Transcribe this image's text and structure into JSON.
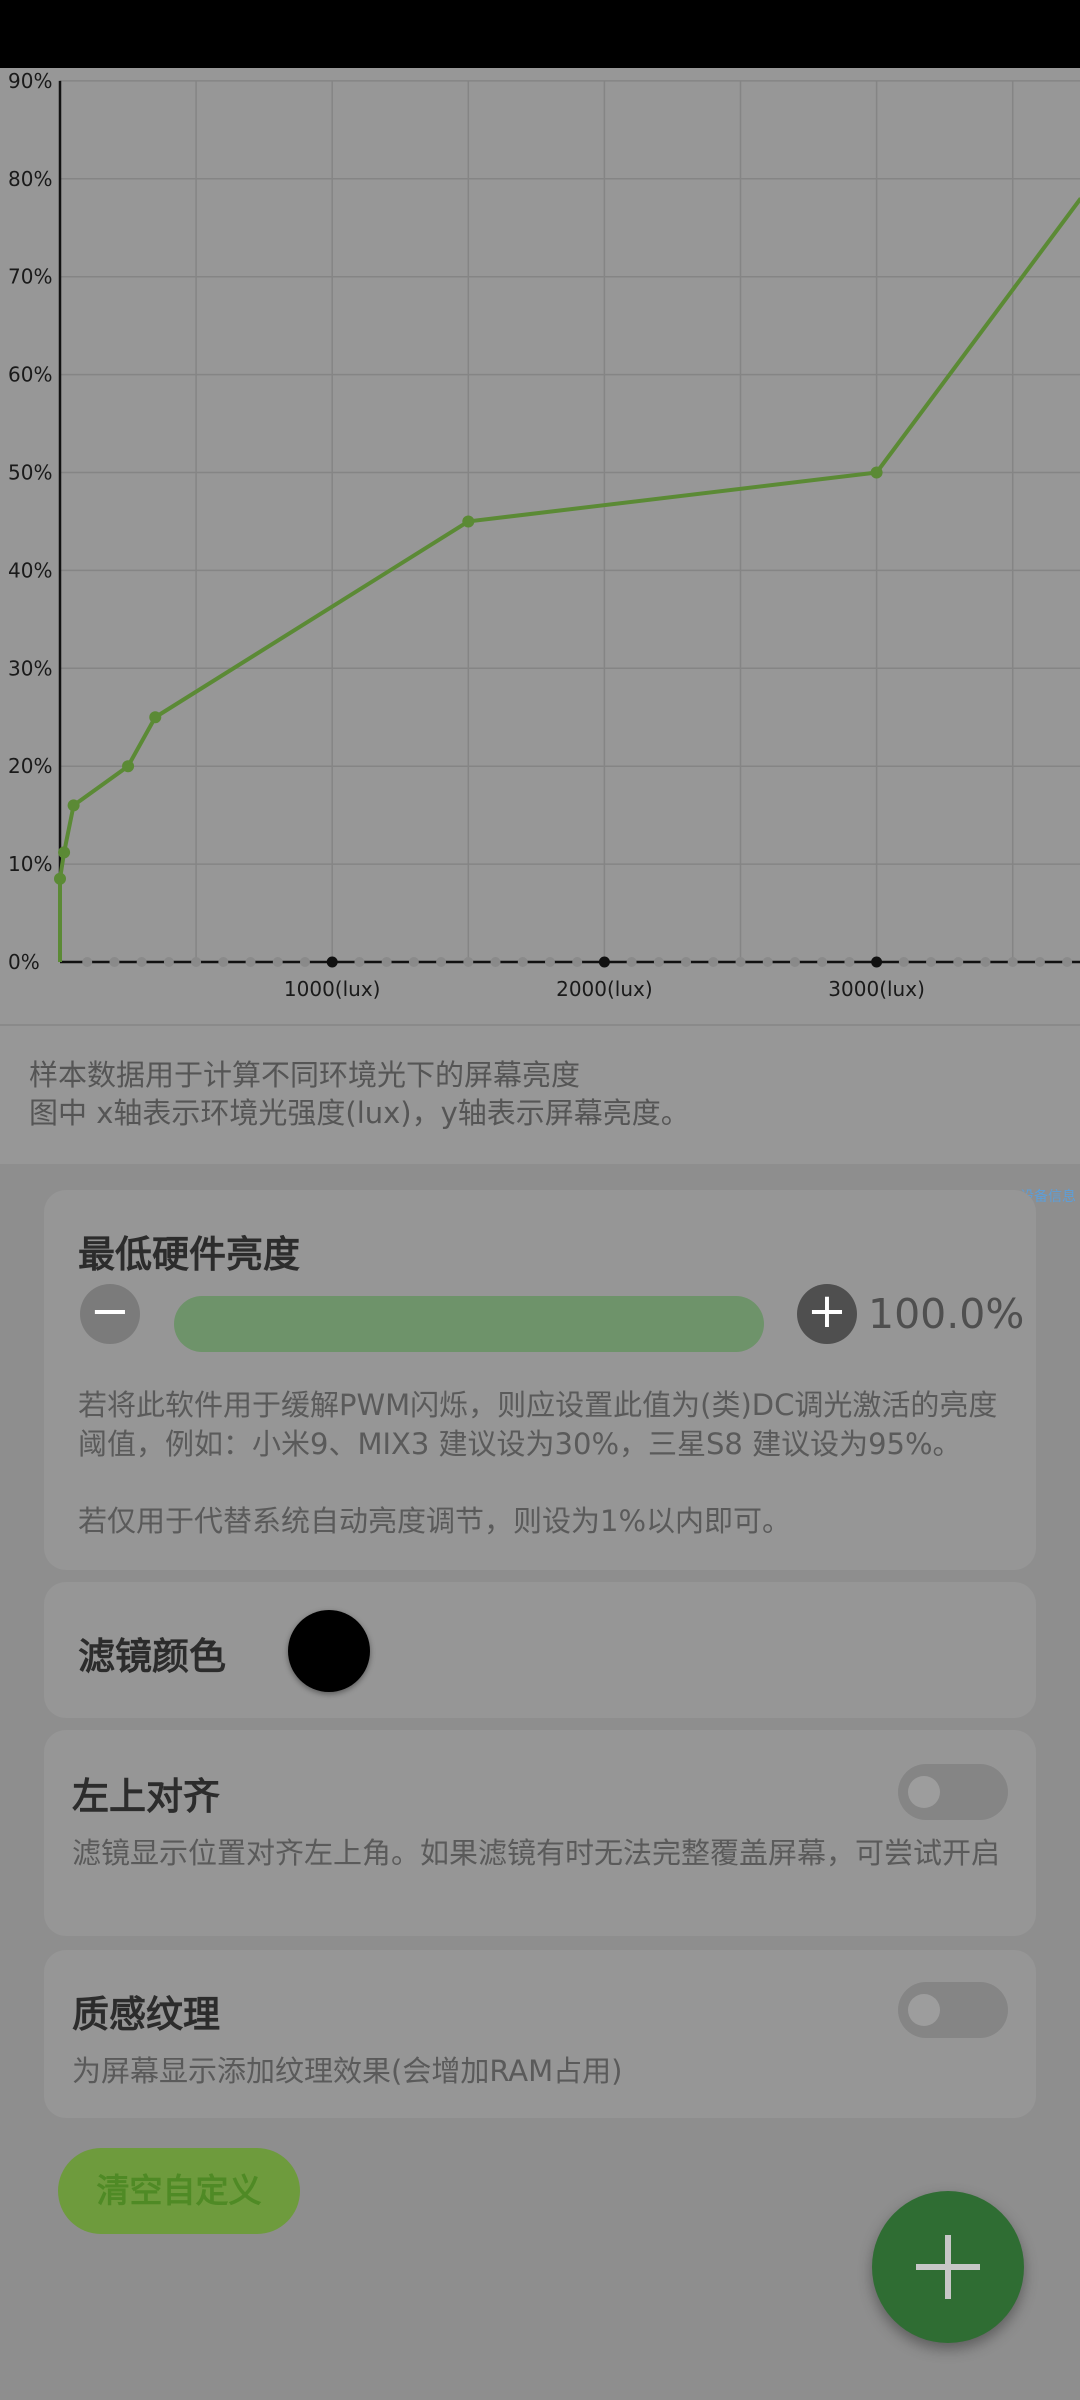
{
  "chart_data": {
    "type": "line",
    "x_unit": "(lux)",
    "x_tick_labels": [
      "1000(lux)",
      "2000(lux)",
      "3000(lux)"
    ],
    "x_ticks": [
      1000,
      2000,
      3000
    ],
    "y_tick_labels": [
      "0%",
      "10%",
      "20%",
      "30%",
      "40%",
      "50%",
      "60%",
      "70%",
      "80%",
      "90%"
    ],
    "xlim": [
      0,
      3750
    ],
    "ylim": [
      0,
      90
    ],
    "grid": true,
    "series": [
      {
        "x": [
          0,
          0,
          15,
          50,
          250,
          350,
          1500,
          3000,
          3750
        ],
        "y": [
          0,
          8.5,
          11.2,
          16,
          20,
          25,
          45,
          50,
          78
        ],
        "color": "#5b8a35"
      }
    ]
  },
  "chart_description": {
    "line1": "样本数据用于计算不同环境光下的屏幕亮度",
    "line2": "图中 x轴表示环境光强度(lux)，y轴表示屏幕亮度。"
  },
  "tiny_link": "设备信息",
  "min_brightness": {
    "title": "最低硬件亮度",
    "minus_label": "−",
    "plus_label": "+",
    "value": "100.0%",
    "slider_fraction": 1.0,
    "desc1": "若将此软件用于缓解PWM闪烁，则应设置此值为(类)DC调光激活的亮度阈值，例如：小米9、MIX3 建议设为30%，三星S8 建议设为95%。",
    "desc2": "若仅用于代替系统自动亮度调节，则设为1%以内即可。"
  },
  "filter_color": {
    "title": "滤镜颜色",
    "color": "#000000"
  },
  "align_top_left": {
    "title": "左上对齐",
    "desc": "滤镜显示位置对齐左上角。如果滤镜有时无法完整覆盖屏幕，可尝试开启",
    "enabled": false
  },
  "texture": {
    "title": "质感纹理",
    "desc": "为屏幕显示添加纹理效果(会增加RAM占用)",
    "enabled": false
  },
  "clear_button": "清空自定义",
  "fab_icon": "plus-icon"
}
